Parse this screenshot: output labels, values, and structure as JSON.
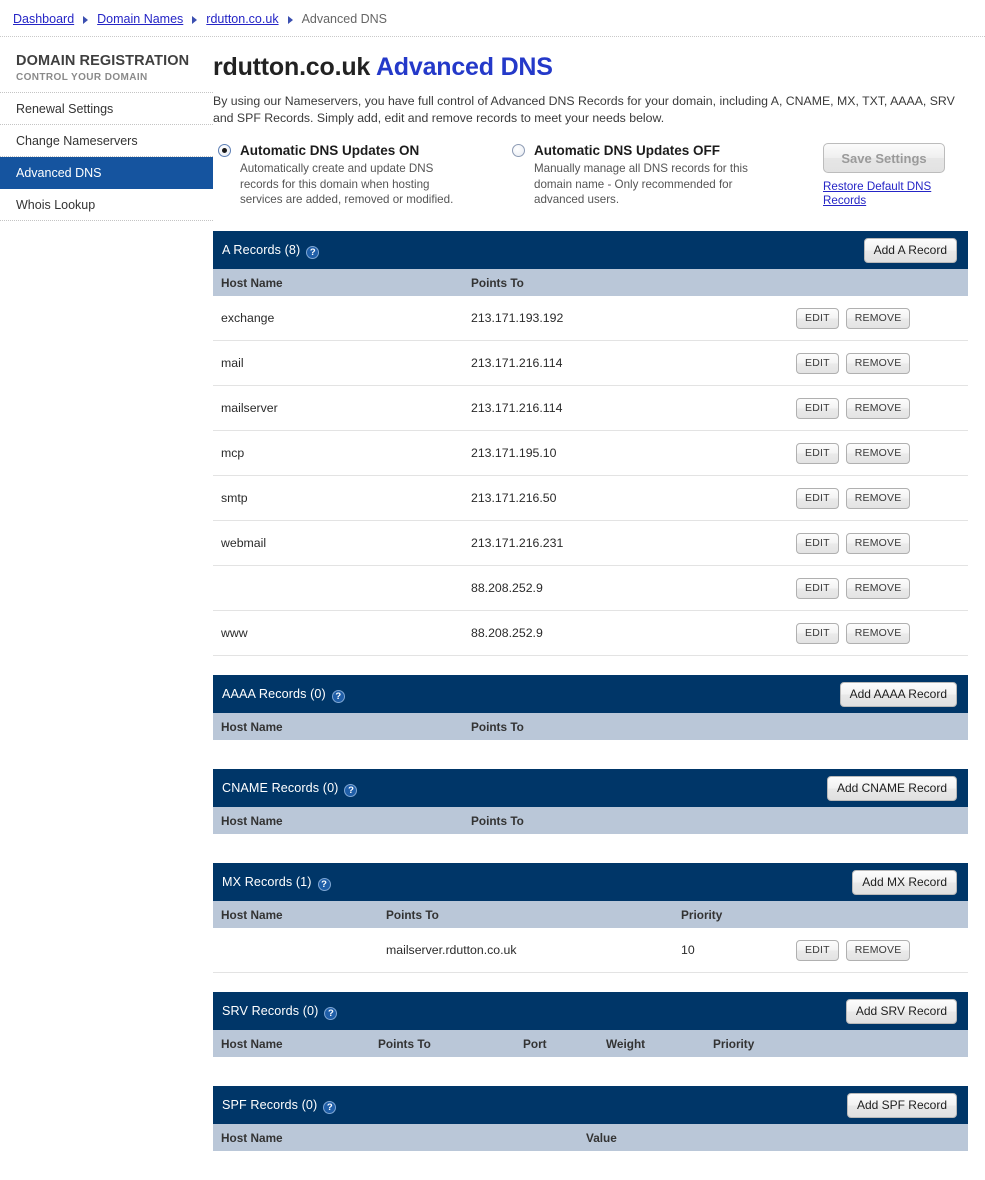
{
  "breadcrumb": {
    "items": [
      {
        "label": "Dashboard",
        "link": true
      },
      {
        "label": "Domain Names",
        "link": true
      },
      {
        "label": "rdutton.co.uk",
        "link": true
      },
      {
        "label": "Advanced DNS",
        "link": false
      }
    ]
  },
  "sidebar": {
    "title": "DOMAIN REGISTRATION",
    "subtitle": "CONTROL YOUR DOMAIN",
    "items": [
      {
        "label": "Renewal Settings",
        "active": false
      },
      {
        "label": "Change Nameservers",
        "active": false
      },
      {
        "label": "Advanced DNS",
        "active": true
      },
      {
        "label": "Whois Lookup",
        "active": false
      }
    ]
  },
  "header": {
    "domain": "rdutton.co.uk ",
    "title_accent": "Advanced DNS",
    "intro": "By using our Nameservers, you have full control of Advanced DNS Records for your domain, including A, CNAME, MX, TXT, AAAA, SRV and SPF Records. Simply add, edit and remove records to meet your needs below."
  },
  "dns_mode": {
    "on": {
      "label": "Automatic DNS Updates ON",
      "description": "Automatically create and update DNS records for this domain when hosting services are added, removed or modified.",
      "selected": true
    },
    "off": {
      "label": "Automatic DNS Updates OFF",
      "description": "Manually manage all DNS records for this domain name - Only recommended for advanced users.",
      "selected": false
    },
    "save_label": "Save Settings",
    "restore_label": "Restore Default DNS Records"
  },
  "common": {
    "edit_label": "EDIT",
    "remove_label": "REMOVE",
    "help_glyph": "?"
  },
  "sections": {
    "a": {
      "title": "A Records (8)",
      "add_label": "Add A Record",
      "columns": [
        "Host Name",
        "Points To"
      ],
      "rows": [
        {
          "host": "exchange",
          "points_to": "213.171.193.192"
        },
        {
          "host": "mail",
          "points_to": "213.171.216.114"
        },
        {
          "host": "mailserver",
          "points_to": "213.171.216.114"
        },
        {
          "host": "mcp",
          "points_to": "213.171.195.10"
        },
        {
          "host": "smtp",
          "points_to": "213.171.216.50"
        },
        {
          "host": "webmail",
          "points_to": "213.171.216.231"
        },
        {
          "host": "",
          "points_to": "88.208.252.9"
        },
        {
          "host": "www",
          "points_to": "88.208.252.9"
        }
      ]
    },
    "aaaa": {
      "title": "AAAA Records (0)",
      "add_label": "Add AAAA Record",
      "columns": [
        "Host Name",
        "Points To"
      ],
      "rows": []
    },
    "cname": {
      "title": "CNAME Records (0)",
      "add_label": "Add CNAME Record",
      "columns": [
        "Host Name",
        "Points To"
      ],
      "rows": []
    },
    "mx": {
      "title": "MX Records (1)",
      "add_label": "Add MX Record",
      "columns": [
        "Host Name",
        "Points To",
        "Priority"
      ],
      "rows": [
        {
          "host": "",
          "points_to": "mailserver.rdutton.co.uk",
          "priority": "10"
        }
      ]
    },
    "srv": {
      "title": "SRV Records (0)",
      "add_label": "Add SRV Record",
      "columns": [
        "Host Name",
        "Points To",
        "Port",
        "Weight",
        "Priority"
      ],
      "rows": []
    },
    "spf": {
      "title": "SPF Records (0)",
      "add_label": "Add SPF Record",
      "columns": [
        "Host Name",
        "Value"
      ],
      "rows": []
    }
  },
  "colors": {
    "header_blue": "#003668",
    "column_header": "#bac7d8",
    "active_nav": "#15549f",
    "link": "#2525c6",
    "accent_title": "#2439c9"
  }
}
